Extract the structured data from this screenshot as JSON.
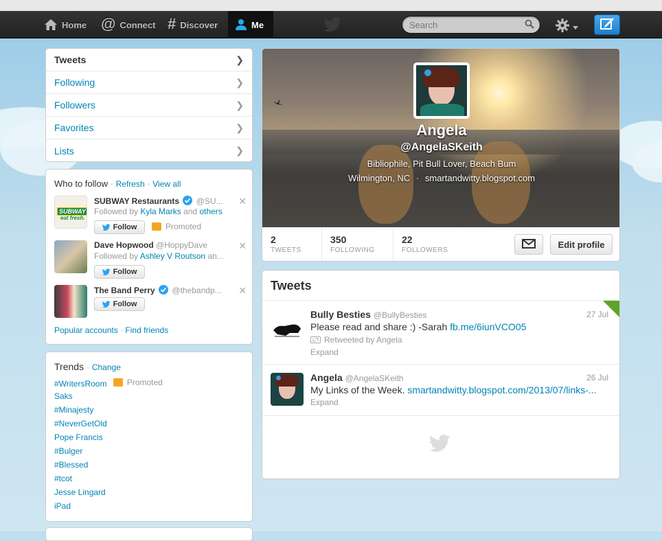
{
  "topnav": {
    "items": [
      {
        "label": "Home",
        "icon": "home-icon"
      },
      {
        "label": "Connect",
        "icon": "at-icon"
      },
      {
        "label": "Discover",
        "icon": "hash-icon"
      },
      {
        "label": "Me",
        "icon": "person-icon"
      }
    ],
    "search_placeholder": "Search"
  },
  "sidenav": {
    "items": [
      "Tweets",
      "Following",
      "Followers",
      "Favorites",
      "Lists"
    ]
  },
  "who_to_follow": {
    "title": "Who to follow",
    "refresh": "Refresh",
    "view_all": "View all",
    "separator": "·",
    "suggestions": [
      {
        "name": "SUBWAY Restaurants",
        "handle": "@SU...",
        "followed_prefix": "Followed by",
        "followed_name": "Kyla Marks",
        "followed_mid": "and",
        "followed_tail": "others",
        "button": "Follow",
        "promoted": "Promoted",
        "verified": true
      },
      {
        "name": "Dave Hopwood",
        "handle": "@HoppyDave",
        "followed_prefix": "Followed by",
        "followed_name": "Ashley V Routson",
        "followed_mid": "an...",
        "button": "Follow"
      },
      {
        "name": "The Band Perry",
        "handle": "@thebandp...",
        "button": "Follow",
        "verified": true
      }
    ],
    "popular": "Popular accounts",
    "find_friends": "Find friends",
    "subway_logo_top": "SUBWAY",
    "subway_logo_bottom": "eat fresh."
  },
  "trends": {
    "title": "Trends",
    "change": "Change",
    "separator": "·",
    "promoted": "Promoted",
    "items": [
      "#WritersRoom",
      "Saks",
      "#Minajesty",
      "#NeverGetOld",
      "Pope Francis",
      "#Bulger",
      "#Blessed",
      "#tcot",
      "Jesse Lingard",
      "iPad"
    ]
  },
  "profile": {
    "name": "Angela",
    "handle": "@AngelaSKeith",
    "bio": "Bibliophile, Pit Bull Lover, Beach Bum",
    "location": "Wilmington, NC",
    "dot": "·",
    "url": "smartandwitty.blogspot.com",
    "stats": [
      {
        "num": "2",
        "label": "TWEETS"
      },
      {
        "num": "350",
        "label": "FOLLOWING"
      },
      {
        "num": "22",
        "label": "FOLLOWERS"
      }
    ],
    "edit_button": "Edit profile"
  },
  "tweets": {
    "title": "Tweets",
    "items": [
      {
        "name": "Bully Besties",
        "handle": "@BullyBesties",
        "date": "27 Jul",
        "text": "Please read and share :) -Sarah",
        "link": "fb.me/6iunVCO05",
        "retweeted_by": "Retweeted by Angela",
        "expand": "Expand"
      },
      {
        "name": "Angela",
        "handle": "@AngelaSKeith",
        "date": "26 Jul",
        "text": "My Links of the Week.",
        "link": "smartandwitty.blogspot.com/2013/07/links-...",
        "expand": "Expand"
      }
    ]
  },
  "colors": {
    "link": "#0084b4",
    "topbar": "#222222",
    "background": "#c0deed",
    "promoted": "#f4a524",
    "verified": "#2aa3ef",
    "retweet_corner": "#5fa32b"
  }
}
